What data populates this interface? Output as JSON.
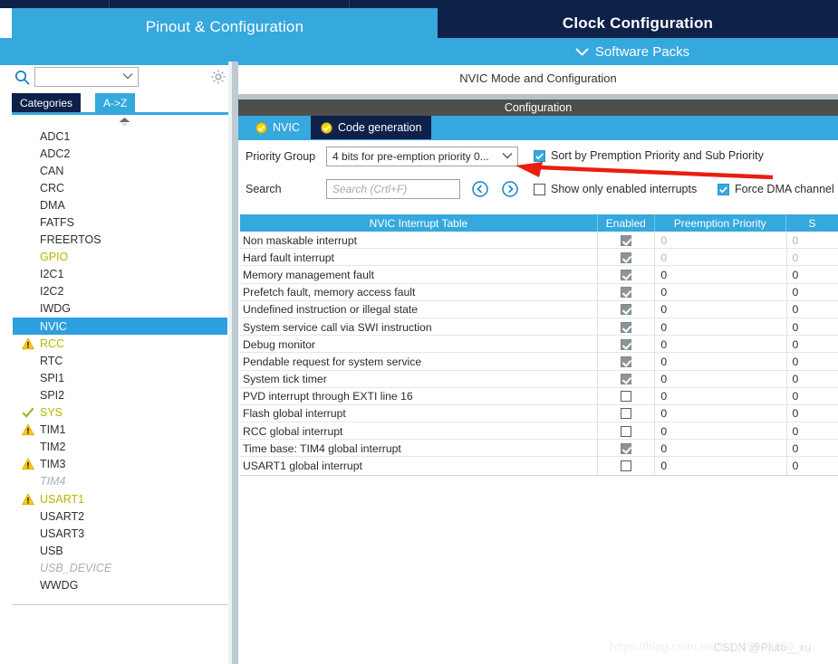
{
  "header": {
    "pinout_tab": "Pinout & Configuration",
    "clock_tab": "Clock Configuration",
    "software_packs": "Software Packs",
    "chevron": "⌄"
  },
  "left_panel": {
    "search_value": "",
    "search_placeholder": "",
    "combo_chevron": "⌄",
    "tabs": [
      {
        "label": "Categories",
        "active": true
      },
      {
        "label": "A->Z",
        "active": false
      }
    ],
    "items": [
      {
        "label": "ADC1",
        "state": "normal",
        "icon": "none"
      },
      {
        "label": "ADC2",
        "state": "normal",
        "icon": "none"
      },
      {
        "label": "CAN",
        "state": "normal",
        "icon": "none"
      },
      {
        "label": "CRC",
        "state": "normal",
        "icon": "none"
      },
      {
        "label": "DMA",
        "state": "normal",
        "icon": "none"
      },
      {
        "label": "FATFS",
        "state": "normal",
        "icon": "none"
      },
      {
        "label": "FREERTOS",
        "state": "normal",
        "icon": "none"
      },
      {
        "label": "GPIO",
        "state": "olive",
        "icon": "none"
      },
      {
        "label": "I2C1",
        "state": "normal",
        "icon": "none"
      },
      {
        "label": "I2C2",
        "state": "normal",
        "icon": "none"
      },
      {
        "label": "IWDG",
        "state": "normal",
        "icon": "none"
      },
      {
        "label": "NVIC",
        "state": "selected",
        "icon": "none"
      },
      {
        "label": "RCC",
        "state": "olive",
        "icon": "warning-icon"
      },
      {
        "label": "RTC",
        "state": "normal",
        "icon": "none"
      },
      {
        "label": "SPI1",
        "state": "normal",
        "icon": "none"
      },
      {
        "label": "SPI2",
        "state": "normal",
        "icon": "none"
      },
      {
        "label": "SYS",
        "state": "olive",
        "icon": "check-icon"
      },
      {
        "label": "TIM1",
        "state": "normal",
        "icon": "warning-icon"
      },
      {
        "label": "TIM2",
        "state": "normal",
        "icon": "none"
      },
      {
        "label": "TIM3",
        "state": "normal",
        "icon": "warning-icon"
      },
      {
        "label": "TIM4",
        "state": "disabled",
        "icon": "none"
      },
      {
        "label": "USART1",
        "state": "olive",
        "icon": "warning-icon"
      },
      {
        "label": "USART2",
        "state": "normal",
        "icon": "none"
      },
      {
        "label": "USART3",
        "state": "normal",
        "icon": "none"
      },
      {
        "label": "USB",
        "state": "normal",
        "icon": "none"
      },
      {
        "label": "USB_DEVICE",
        "state": "disabled",
        "icon": "none"
      },
      {
        "label": "WWDG",
        "state": "normal",
        "icon": "none"
      }
    ]
  },
  "right_panel": {
    "mode_title": "NVIC Mode and Configuration",
    "configuration_bar": "Configuration",
    "tabs": [
      {
        "label": "NVIC",
        "active": true
      },
      {
        "label": "Code generation",
        "active": false
      }
    ],
    "priority_group_label": "Priority Group",
    "priority_group_value": "4 bits for pre-emption priority 0...",
    "priority_group_chevron": "⌄",
    "search_label": "Search",
    "search_placeholder": "Search (Crtl+F)",
    "search_value": "",
    "checkboxes": {
      "sort_label": "Sort by Premption Priority and Sub Priority",
      "sort_checked": true,
      "show_only_label": "Show only enabled interrupts",
      "show_only_checked": false,
      "force_dma_label": "Force DMA channel",
      "force_dma_checked": true
    },
    "table": {
      "columns": [
        "NVIC Interrupt Table",
        "Enabled",
        "Preemption Priority",
        "S"
      ],
      "rows": [
        {
          "name": "Non maskable interrupt",
          "enabled": true,
          "locked": true,
          "preemption": "0",
          "sub": "0"
        },
        {
          "name": "Hard fault interrupt",
          "enabled": true,
          "locked": true,
          "preemption": "0",
          "sub": "0"
        },
        {
          "name": "Memory management fault",
          "enabled": true,
          "locked": false,
          "preemption": "0",
          "sub": "0"
        },
        {
          "name": "Prefetch fault, memory access fault",
          "enabled": true,
          "locked": false,
          "preemption": "0",
          "sub": "0"
        },
        {
          "name": "Undefined instruction or illegal state",
          "enabled": true,
          "locked": false,
          "preemption": "0",
          "sub": "0"
        },
        {
          "name": "System service call via SWI instruction",
          "enabled": true,
          "locked": false,
          "preemption": "0",
          "sub": "0"
        },
        {
          "name": "Debug monitor",
          "enabled": true,
          "locked": false,
          "preemption": "0",
          "sub": "0"
        },
        {
          "name": "Pendable request for system service",
          "enabled": true,
          "locked": false,
          "preemption": "0",
          "sub": "0"
        },
        {
          "name": "System tick timer",
          "enabled": true,
          "locked": false,
          "preemption": "0",
          "sub": "0"
        },
        {
          "name": "PVD interrupt through EXTI line 16",
          "enabled": false,
          "locked": false,
          "preemption": "0",
          "sub": "0"
        },
        {
          "name": "Flash global interrupt",
          "enabled": false,
          "locked": false,
          "preemption": "0",
          "sub": "0"
        },
        {
          "name": "RCC global interrupt",
          "enabled": false,
          "locked": false,
          "preemption": "0",
          "sub": "0"
        },
        {
          "name": "Time base: TIM4 global interrupt",
          "enabled": true,
          "locked": false,
          "preemption": "0",
          "sub": "0"
        },
        {
          "name": "USART1 global interrupt",
          "enabled": false,
          "locked": false,
          "preemption": "0",
          "sub": "0"
        }
      ]
    }
  },
  "watermark": {
    "url": "https://blog.csdn.net/qq_45947150",
    "handle": "CSDN @Pluto__xu"
  },
  "colors": {
    "accent_blue": "#35a8dd",
    "dark_navy": "#0d2149",
    "olive": "#b5b800",
    "warning_yellow": "#ffc107",
    "annotation_red": "#e81e12"
  }
}
